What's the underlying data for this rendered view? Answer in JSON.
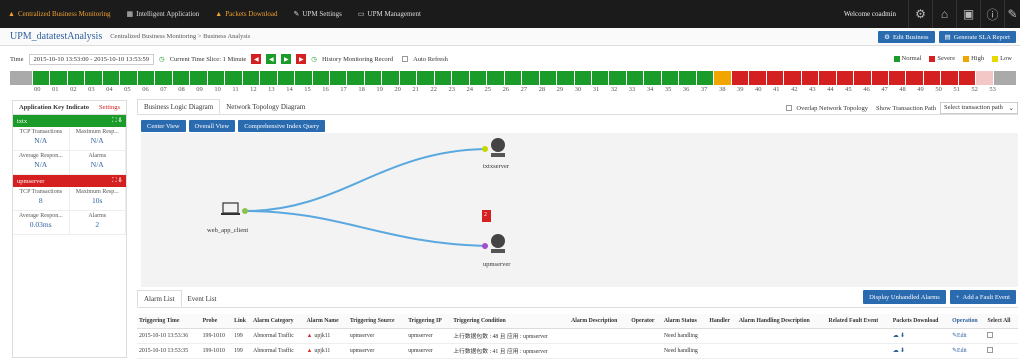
{
  "nav": [
    "Centralized Business Monitoring",
    "Intelligent Application",
    "Packets Download",
    "UPM Settings",
    "UPM Management"
  ],
  "welcome": "Welcome coadmin",
  "app_title": "UPM_datatestAnalysis",
  "breadcrumb": "Centralized Business Monitoring > Business Analysis",
  "edit_business": "Edit Business",
  "gen_sla": "Generate SLA Report",
  "time_label": "Time",
  "time_range": "2015-10-10 13:53:00 - 2015-10-10 13:53:59",
  "slice": "Current Time Slice: 1 Minute",
  "history": "History Monitoring Record",
  "auto_refresh": "Auto Refresh",
  "legend": [
    {
      "label": "Normal",
      "color": "#1a9b2a"
    },
    {
      "label": "Severe",
      "color": "#d42020"
    },
    {
      "label": "High",
      "color": "#f0a500"
    },
    {
      "label": "Low",
      "color": "#e8d800"
    }
  ],
  "timeline": {
    "statuses": [
      "Normal",
      "Normal",
      "Normal",
      "Normal",
      "Normal",
      "Normal",
      "Normal",
      "Normal",
      "Normal",
      "Normal",
      "Normal",
      "Normal",
      "Normal",
      "Normal",
      "Normal",
      "Normal",
      "Normal",
      "Normal",
      "Normal",
      "Normal",
      "Normal",
      "Normal",
      "Normal",
      "Normal",
      "Normal",
      "Normal",
      "Normal",
      "Normal",
      "Normal",
      "Normal",
      "Normal",
      "Normal",
      "Normal",
      "Normal",
      "Normal",
      "Normal",
      "Normal",
      "Normal",
      "Normal",
      "High",
      "Severe",
      "Severe",
      "Severe",
      "Severe",
      "Severe",
      "Severe",
      "Severe",
      "Severe",
      "Severe",
      "Severe",
      "Severe",
      "Severe",
      "Severe",
      "Severe"
    ],
    "ticks": [
      "00",
      "01",
      "02",
      "03",
      "04",
      "05",
      "06",
      "07",
      "08",
      "09",
      "10",
      "11",
      "12",
      "13",
      "14",
      "15",
      "16",
      "17",
      "18",
      "19",
      "20",
      "21",
      "22",
      "23",
      "24",
      "25",
      "26",
      "27",
      "28",
      "29",
      "30",
      "31",
      "32",
      "33",
      "34",
      "35",
      "36",
      "37",
      "38",
      "39",
      "40",
      "41",
      "42",
      "43",
      "44",
      "45",
      "46",
      "47",
      "48",
      "49",
      "50",
      "51",
      "52",
      "53"
    ]
  },
  "left": {
    "title": "Application Key Indicato",
    "settings": "Settings",
    "groups": [
      {
        "name": "txtx",
        "color": "#1a9b2a",
        "metrics": [
          {
            "label": "TCP Transactions",
            "value": "N/A"
          },
          {
            "label": "Maximum Resp...",
            "value": "N/A"
          },
          {
            "label": "Average Respon...",
            "value": "N/A"
          },
          {
            "label": "Alarms",
            "value": "N/A"
          }
        ]
      },
      {
        "name": "upmserver",
        "color": "#d42020",
        "metrics": [
          {
            "label": "TCP Transactions",
            "value": "8"
          },
          {
            "label": "Maximum Resp...",
            "value": "10s"
          },
          {
            "label": "Average Respon...",
            "value": "0.03ms"
          },
          {
            "label": "Alarms",
            "value": "2"
          }
        ]
      }
    ]
  },
  "main": {
    "tab1": "Business Logic Diagram",
    "tab2": "Network Topology Diagram",
    "overlap": "Overlap Network Topology",
    "show_path": "Show Transaction Path",
    "select_path": "Select transaction path",
    "center_view": "Center View",
    "overall_view": "Overall View",
    "index_query": "Comprehensive Index Query",
    "nodes": {
      "client": "web_app_client",
      "txtx": "txtxserver",
      "upm": "upmserver",
      "badge": "2"
    }
  },
  "bottom": {
    "tab1": "Alarm List",
    "tab2": "Event List",
    "display_unhandled": "Display Unhandled Alarms",
    "add_fault": "Add a Fault Event",
    "headers": [
      "Triggering Time",
      "Probe",
      "Link",
      "Alarm Category",
      "Alarm Name",
      "Triggering Source",
      "Triggering IP",
      "Triggering Condition",
      "Alarm Description",
      "Operator",
      "Alarm Status",
      "Handler",
      "Alarm Handling Description",
      "Related Fault Event",
      "Packets Download",
      "Operation",
      "Select All"
    ],
    "rows": [
      {
        "time": "2015-10-10 13:53:36",
        "probe": "199-1010",
        "link": "199",
        "cat": "Abnormal Traffic",
        "name": "upjk11",
        "src": "upmserver",
        "ip": "upmserver",
        "cond": "上行数据包数 : 48 且 应用 : upmserver",
        "status": "Need handling",
        "op": "Edit"
      },
      {
        "time": "2015-10-10 13:53:35",
        "probe": "199-1010",
        "link": "199",
        "cat": "Abnormal Traffic",
        "name": "upjk11",
        "src": "upmserver",
        "ip": "upmserver",
        "cond": "上行数据包数 : 41 且 应用 : upmserver",
        "status": "Need handling",
        "op": "Edit"
      }
    ]
  }
}
